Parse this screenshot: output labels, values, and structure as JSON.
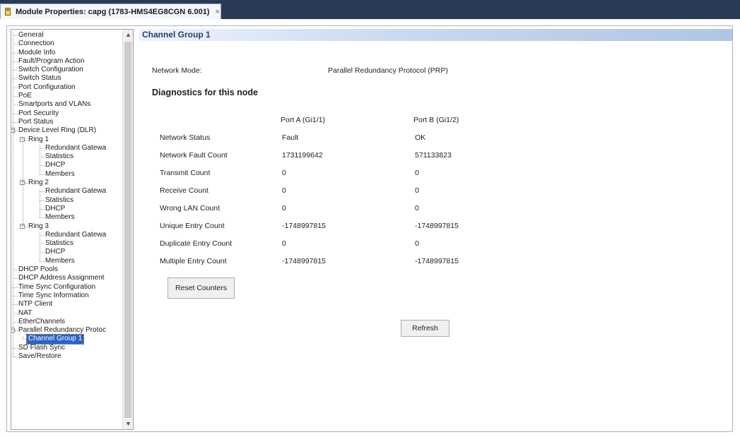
{
  "window": {
    "tab_title": "Module Properties: capg (1783-HMS4EG8CGN 6.001)",
    "close_glyph": "×",
    "tab_icon": "module-icon"
  },
  "tree": {
    "items": [
      {
        "label": "General",
        "level": 0
      },
      {
        "label": "Connection",
        "level": 0
      },
      {
        "label": "Module Info",
        "level": 0
      },
      {
        "label": "Fault/Program Action",
        "level": 0
      },
      {
        "label": "Switch Configuration",
        "level": 0
      },
      {
        "label": "Switch Status",
        "level": 0
      },
      {
        "label": "Port Configuration",
        "level": 0
      },
      {
        "label": "PoE",
        "level": 0
      },
      {
        "label": "Smartports and VLANs",
        "level": 0
      },
      {
        "label": "Port Security",
        "level": 0
      },
      {
        "label": "Port Status",
        "level": 0
      },
      {
        "label": "Device Level Ring (DLR)",
        "level": 0,
        "expanded": true
      },
      {
        "label": "Ring 1",
        "level": 1,
        "expanded": true
      },
      {
        "label": "Redundant Gatewa",
        "level": 2
      },
      {
        "label": "Statistics",
        "level": 2
      },
      {
        "label": "DHCP",
        "level": 2
      },
      {
        "label": "Members",
        "level": 2
      },
      {
        "label": "Ring 2",
        "level": 1,
        "expanded": true
      },
      {
        "label": "Redundant Gatewa",
        "level": 2
      },
      {
        "label": "Statistics",
        "level": 2
      },
      {
        "label": "DHCP",
        "level": 2
      },
      {
        "label": "Members",
        "level": 2
      },
      {
        "label": "Ring 3",
        "level": 1,
        "expanded": true
      },
      {
        "label": "Redundant Gatewa",
        "level": 2
      },
      {
        "label": "Statistics",
        "level": 2
      },
      {
        "label": "DHCP",
        "level": 2
      },
      {
        "label": "Members",
        "level": 2
      },
      {
        "label": "DHCP Pools",
        "level": 0
      },
      {
        "label": "DHCP Address Assignment",
        "level": 0
      },
      {
        "label": "Time Sync Configuration",
        "level": 0
      },
      {
        "label": "Time Sync Information",
        "level": 0
      },
      {
        "label": "NTP Client",
        "level": 0
      },
      {
        "label": "NAT",
        "level": 0
      },
      {
        "label": "EtherChannels",
        "level": 0
      },
      {
        "label": "Parallel Redundancy Protoc",
        "level": 0,
        "expanded": true
      },
      {
        "label": "Channel Group 1",
        "level": 1,
        "selected": true
      },
      {
        "label": "SD Flash Sync",
        "level": 0
      },
      {
        "label": "Save/Restore",
        "level": 0
      }
    ],
    "scroll_up_glyph": "▲",
    "scroll_down_glyph": "▼"
  },
  "content": {
    "group_title": "Channel Group 1",
    "network_mode_label": "Network Mode:",
    "network_mode_value": "Parallel Redundancy Protocol (PRP)",
    "diagnostics_heading": "Diagnostics for this node",
    "port_a_header": "Port A (Gi1/1)",
    "port_b_header": "Port B (Gi1/2)",
    "rows": [
      {
        "label": "Network Status",
        "port_a": "Fault",
        "port_b": "OK"
      },
      {
        "label": "Network Fault Count",
        "port_a": "1731199642",
        "port_b": "571133823"
      },
      {
        "label": "Transmit Count",
        "port_a": "0",
        "port_b": "0"
      },
      {
        "label": "Receive Count",
        "port_a": "0",
        "port_b": "0"
      },
      {
        "label": "Wrong LAN Count",
        "port_a": "0",
        "port_b": "0"
      },
      {
        "label": "Unique Entry Count",
        "port_a": "-1748997815",
        "port_b": "-1748997815"
      },
      {
        "label": "Duplicate Entry Count",
        "port_a": "0",
        "port_b": "0"
      },
      {
        "label": "Multiple Entry Count",
        "port_a": "-1748997815",
        "port_b": "-1748997815"
      }
    ],
    "reset_button": "Reset Counters",
    "refresh_button": "Refresh"
  }
}
